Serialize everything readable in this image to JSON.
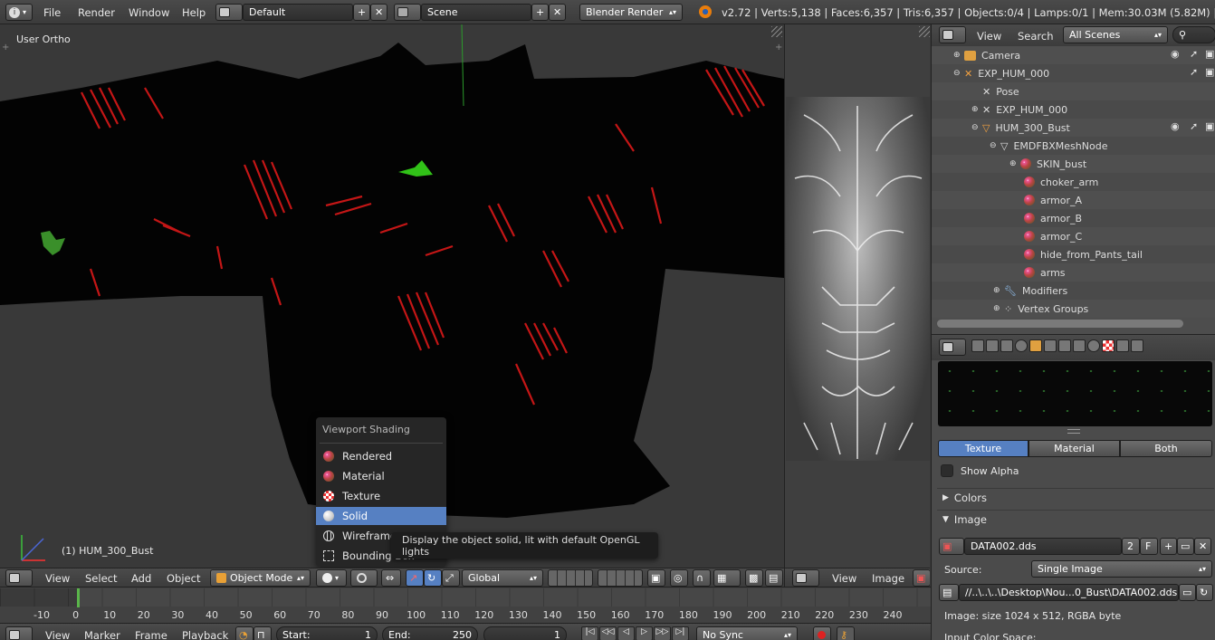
{
  "topbar": {
    "menus": [
      "File",
      "Render",
      "Window",
      "Help"
    ],
    "layout": "Default",
    "scene": "Scene",
    "engine": "Blender Render",
    "stats": "v2.72 | Verts:5,138 | Faces:6,357 | Tris:6,357 | Objects:0/4 | Lamps:0/1 | Mem:30.03M (5.82M) | HUM_300"
  },
  "viewport": {
    "view_name": "User Ortho",
    "object_label": "(1) HUM_300_Bust",
    "menus": [
      "View",
      "Select",
      "Add",
      "Object"
    ],
    "mode": "Object Mode",
    "orientation": "Global"
  },
  "shading_menu": {
    "title": "Viewport Shading",
    "items": [
      {
        "label": "Rendered",
        "icon": "rendered-icon"
      },
      {
        "label": "Material",
        "icon": "material-icon"
      },
      {
        "label": "Texture",
        "icon": "texture-icon"
      },
      {
        "label": "Solid",
        "icon": "solid-icon"
      },
      {
        "label": "Wireframe",
        "icon": "wireframe-icon"
      },
      {
        "label": "Bounding Box",
        "icon": "bounding-box-icon"
      }
    ],
    "selected": "Solid",
    "tooltip": "Display the object solid, lit with default OpenGL lights"
  },
  "uv_editor": {
    "menus": [
      "View",
      "Image"
    ]
  },
  "outliner": {
    "menus": [
      "View",
      "Search"
    ],
    "filter": "All Scenes",
    "items": [
      {
        "label": "Camera",
        "depth": 0
      },
      {
        "label": "EXP_HUM_000",
        "depth": 0
      },
      {
        "label": "Pose",
        "depth": 1
      },
      {
        "label": "EXP_HUM_000",
        "depth": 1
      },
      {
        "label": "HUM_300_Bust",
        "depth": 1
      },
      {
        "label": "EMDFBXMeshNode",
        "depth": 2
      },
      {
        "label": "SKIN_bust",
        "depth": 3
      },
      {
        "label": "choker_arm",
        "depth": 3
      },
      {
        "label": "armor_A",
        "depth": 3
      },
      {
        "label": "armor_B",
        "depth": 3
      },
      {
        "label": "armor_C",
        "depth": 3
      },
      {
        "label": "hide_from_Pants_tail",
        "depth": 3
      },
      {
        "label": "arms",
        "depth": 3
      },
      {
        "label": "Modifiers",
        "depth": 2
      },
      {
        "label": "Vertex Groups",
        "depth": 2
      }
    ]
  },
  "properties": {
    "tabs": [
      "Texture",
      "Material",
      "Both"
    ],
    "active_tab": "Texture",
    "show_alpha": "Show Alpha",
    "colors_panel": "Colors",
    "image_panel": "Image",
    "image_name": "DATA002.dds",
    "users": "2",
    "fake": "F",
    "source_label": "Source:",
    "source_value": "Single Image",
    "filepath": "//..\\..\\..\\Desktop\\Nou...0_Bust\\DATA002.dds",
    "image_info": "Image: size 1024 x 512, RGBA byte",
    "color_space": "Input Color Space:"
  },
  "timeline": {
    "ticks": [
      "-10",
      "0",
      "10",
      "20",
      "30",
      "40",
      "50",
      "60",
      "70",
      "80",
      "90",
      "100",
      "110",
      "120",
      "130",
      "140",
      "150",
      "160",
      "170",
      "180",
      "190",
      "200",
      "210",
      "220",
      "230",
      "240"
    ],
    "menus": [
      "View",
      "Marker",
      "Frame",
      "Playback"
    ],
    "start": "Start:",
    "start_val": "1",
    "end": "End:",
    "end_val": "250",
    "current": "1",
    "sync": "No Sync"
  }
}
